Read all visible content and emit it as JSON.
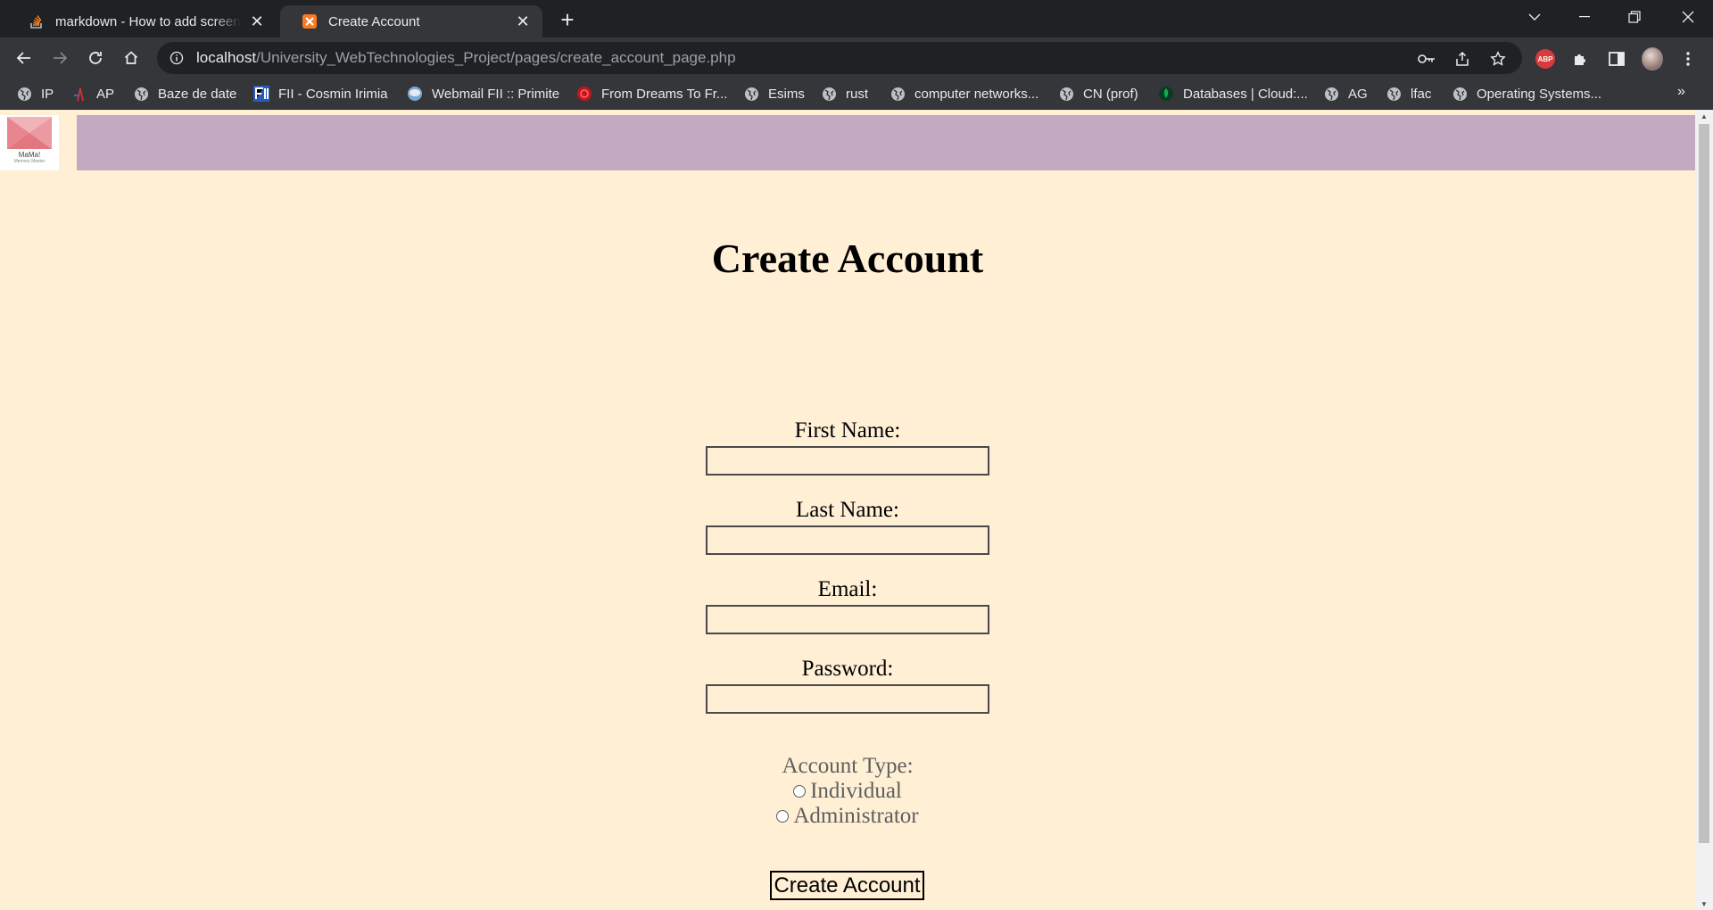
{
  "browser": {
    "tabs": [
      {
        "title": "markdown - How to add screenshot",
        "active": false,
        "favicon": "stackoverflow-icon"
      },
      {
        "title": "Create Account",
        "active": true,
        "favicon": "xampp-icon"
      }
    ],
    "address_bar": {
      "host": "localhost",
      "path": "/University_WebTechnologies_Project/pages/create_account_page.php"
    },
    "bookmarks": [
      {
        "label": "IP",
        "icon": "globe-icon"
      },
      {
        "label": "AP",
        "icon": "ap-icon"
      },
      {
        "label": "Baze de date",
        "icon": "globe-icon"
      },
      {
        "label": "FII - Cosmin Irimia",
        "icon": "fii-icon"
      },
      {
        "label": "Webmail FII :: Primite",
        "icon": "webmail-icon"
      },
      {
        "label": "From Dreams To Fr...",
        "icon": "red-circle-icon"
      },
      {
        "label": "Esims",
        "icon": "globe-icon"
      },
      {
        "label": "rust",
        "icon": "globe-icon"
      },
      {
        "label": "computer networks...",
        "icon": "globe-icon"
      },
      {
        "label": "CN (prof)",
        "icon": "globe-icon"
      },
      {
        "label": "Databases | Cloud:...",
        "icon": "mongodb-leaf-icon"
      },
      {
        "label": "AG",
        "icon": "globe-icon"
      },
      {
        "label": "lfac",
        "icon": "globe-icon"
      },
      {
        "label": "Operating Systems...",
        "icon": "globe-icon"
      }
    ],
    "bookmarks_overflow": "»"
  },
  "page": {
    "logo": {
      "text": "MaMa!",
      "subtext": "Memory Master"
    },
    "title": "Create Account",
    "fields": [
      {
        "label": "First Name:",
        "value": ""
      },
      {
        "label": "Last Name:",
        "value": ""
      },
      {
        "label": "Email:",
        "value": ""
      },
      {
        "label": "Password:",
        "value": ""
      }
    ],
    "account_type": {
      "label": "Account Type:",
      "options": [
        "Individual",
        "Administrator"
      ],
      "selected": null
    },
    "submit_label": "Create Account"
  },
  "colors": {
    "page_background": "#ffefd5",
    "header_bar": "#c3a9c1",
    "browser_frame": "#202124",
    "toolbar": "#35363a"
  }
}
